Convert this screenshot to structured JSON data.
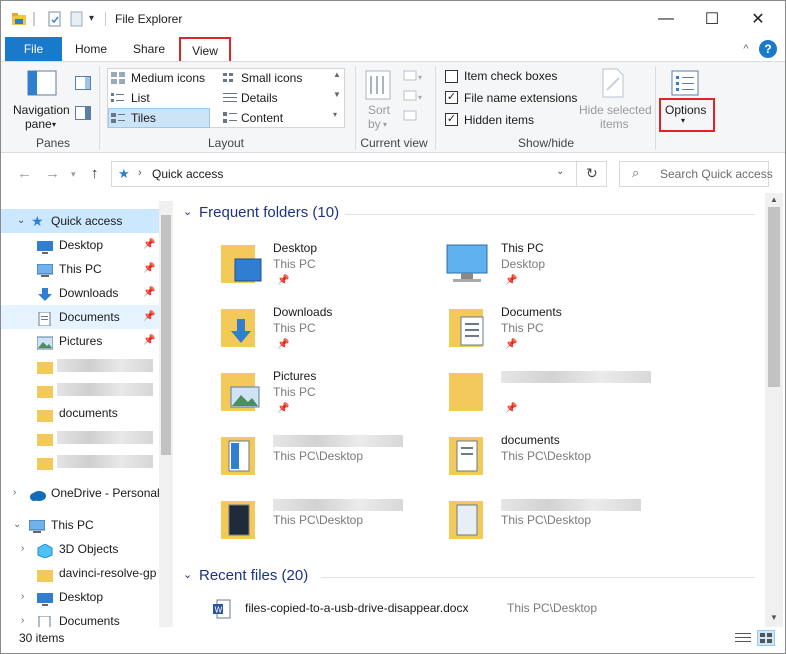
{
  "window": {
    "title": "File Explorer",
    "min_glyph": "—",
    "max_glyph": "☐",
    "close_glyph": "✕",
    "help_glyph": "?",
    "collapse_glyph": "^"
  },
  "tabs": [
    {
      "label": "File"
    },
    {
      "label": "Home"
    },
    {
      "label": "Share"
    },
    {
      "label": "View"
    }
  ],
  "ribbon": {
    "panes": {
      "nav_label": "Navigation",
      "nav_label2": "pane",
      "group": "Panes"
    },
    "layout": {
      "items": [
        "Medium icons",
        "Small icons",
        "List",
        "Details",
        "Tiles",
        "Content"
      ],
      "group": "Layout"
    },
    "current_view": {
      "sort_label": "Sort",
      "sort_label2": "by",
      "group": "Current view"
    },
    "show_hide": {
      "item_check_boxes": "Item check boxes",
      "file_name_extensions": "File name extensions",
      "hidden_items": "Hidden items",
      "hide_selected": "Hide selected",
      "hide_selected2": "items",
      "group": "Show/hide",
      "item_check_boxes_checked": false,
      "file_name_extensions_checked": true,
      "hidden_items_checked": true
    },
    "options": {
      "label": "Options"
    }
  },
  "address": {
    "crumb": "Quick access",
    "search_placeholder": "Search Quick access"
  },
  "navpane": {
    "quick_access": "Quick access",
    "items": [
      "Desktop",
      "This PC",
      "Downloads",
      "Documents",
      "Pictures"
    ],
    "documents2": "documents",
    "onedrive": "OneDrive - Personal",
    "thispc": "This PC",
    "pc_items": [
      "3D Objects",
      "davinci-resolve-gp",
      "Desktop",
      "Documents"
    ]
  },
  "content": {
    "frequent_header": "Frequent folders (10)",
    "recent_header": "Recent files (20)",
    "tiles": [
      {
        "name": "Desktop",
        "loc": "This PC"
      },
      {
        "name": "This PC",
        "loc": "Desktop"
      },
      {
        "name": "Downloads",
        "loc": "This PC"
      },
      {
        "name": "Documents",
        "loc": "This PC"
      },
      {
        "name": "Pictures",
        "loc": "This PC"
      },
      {
        "name": "",
        "loc": ""
      },
      {
        "name": "",
        "loc": "This PC\\Desktop"
      },
      {
        "name": "documents",
        "loc": "This PC\\Desktop"
      },
      {
        "name": "",
        "loc": "This PC\\Desktop"
      },
      {
        "name": "",
        "loc": "This PC\\Desktop"
      }
    ],
    "recent_file": {
      "name": "files-copied-to-a-usb-drive-disappear.docx",
      "loc": "This PC\\Desktop"
    }
  },
  "status": {
    "count": "30 items"
  },
  "colors": {
    "accent": "#1979ca",
    "highlight": "#e0242a",
    "header_blue": "#1e3287"
  }
}
